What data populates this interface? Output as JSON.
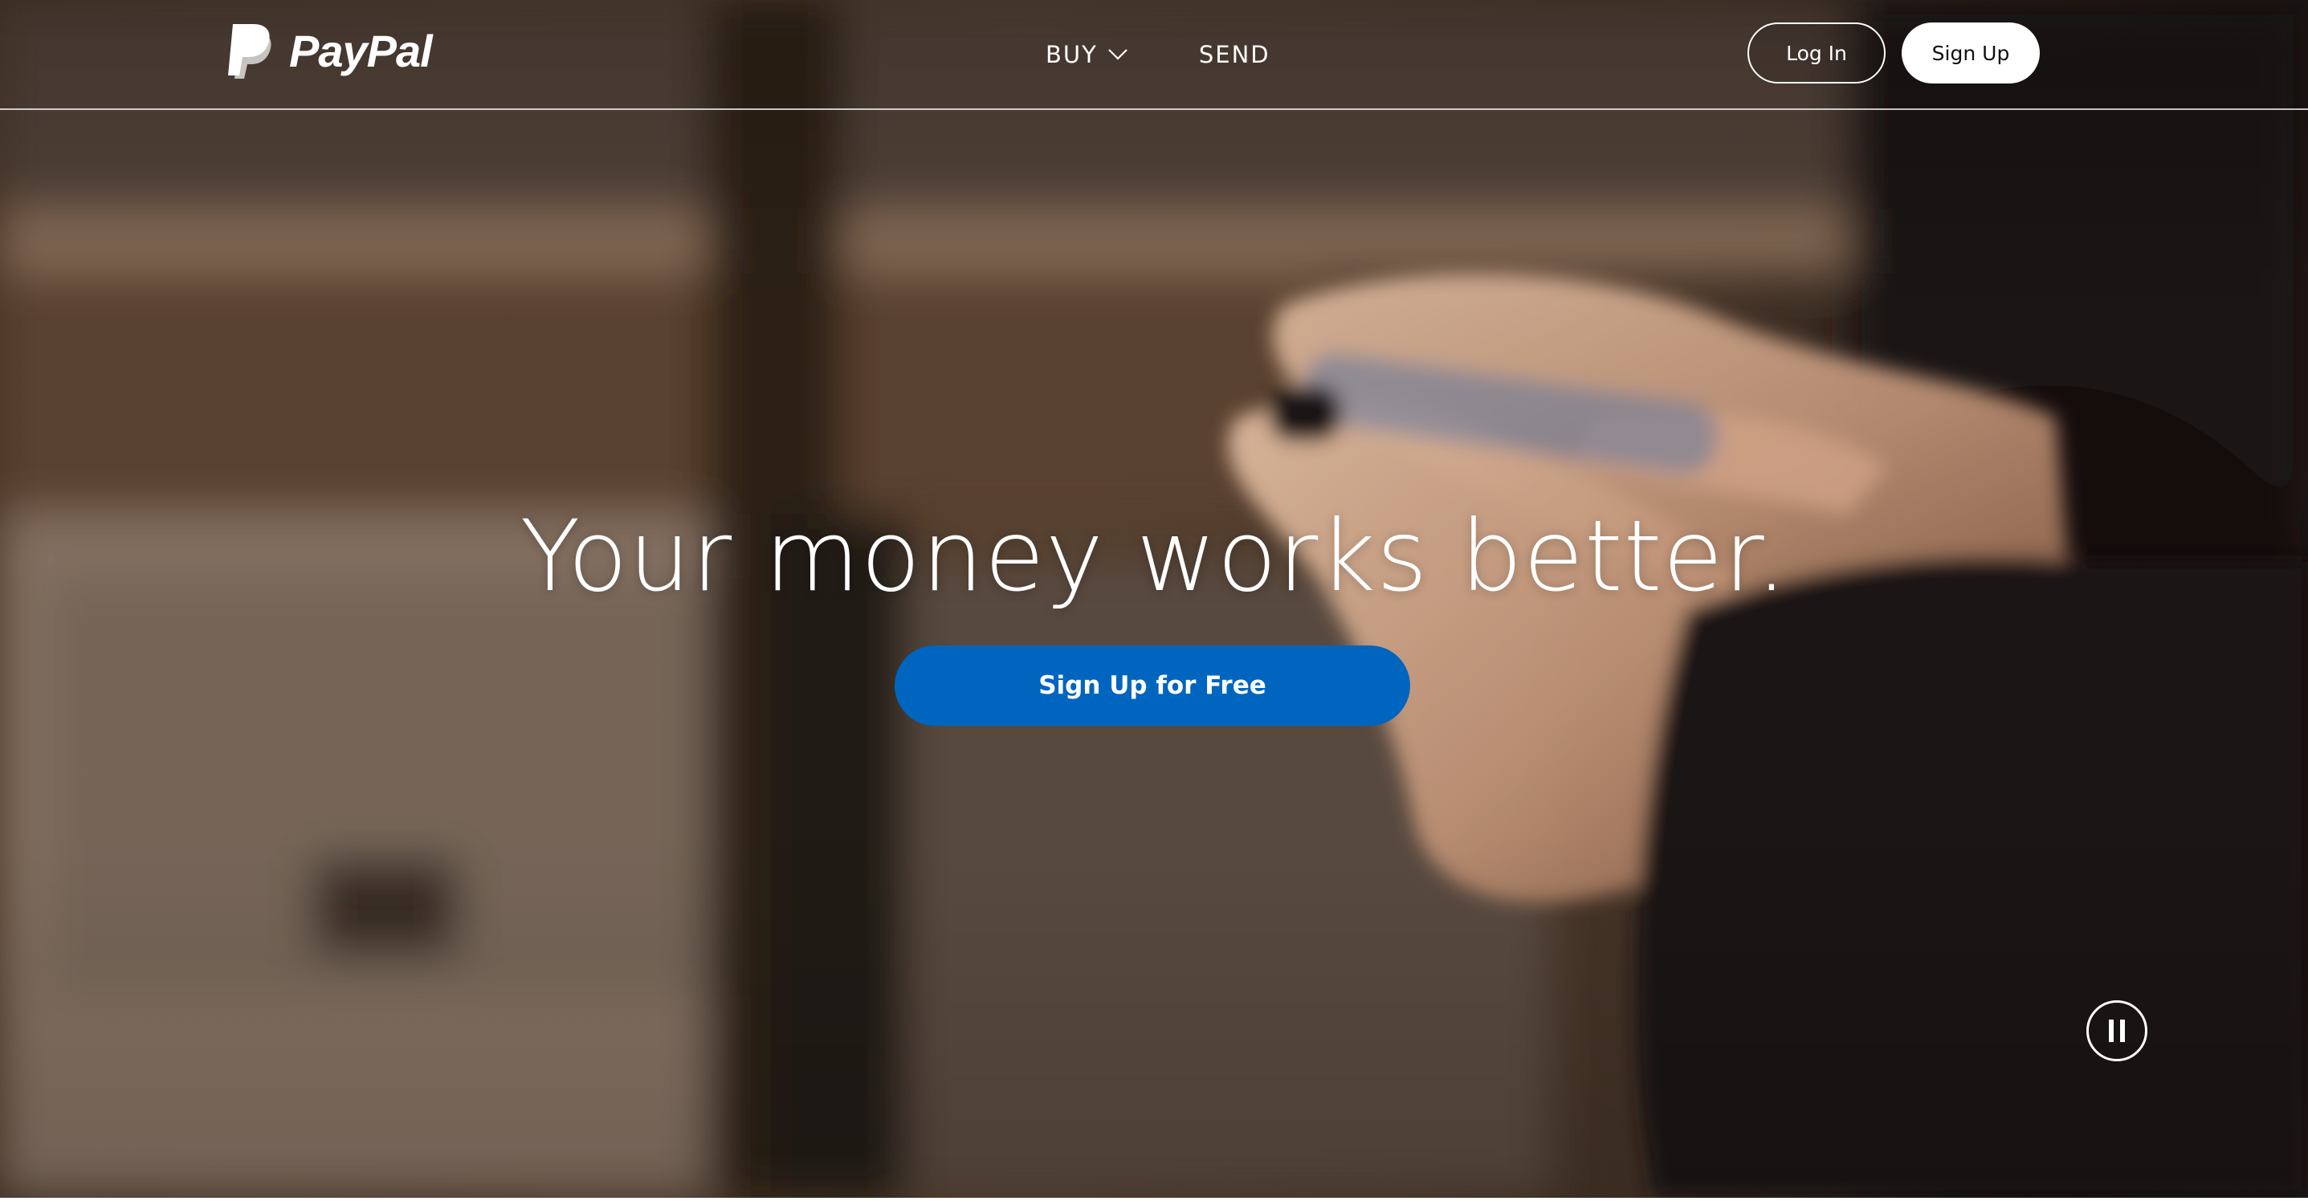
{
  "brand": {
    "name": "PayPal"
  },
  "nav": {
    "items": [
      {
        "label": "BUY",
        "has_dropdown": true
      },
      {
        "label": "SEND",
        "has_dropdown": false
      }
    ]
  },
  "auth": {
    "login_label": "Log In",
    "signup_label": "Sign Up"
  },
  "hero": {
    "headline": "Your money works better.",
    "cta_label": "Sign Up for Free",
    "video_control": "pause-icon"
  },
  "colors": {
    "cta_blue": "#0065bf",
    "header_text": "#ffffff",
    "signup_bg": "#ffffff"
  }
}
